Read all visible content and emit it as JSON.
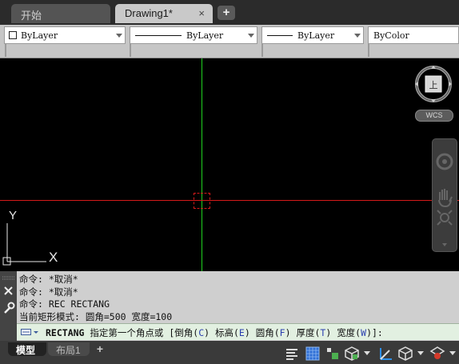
{
  "tabs": {
    "start_label": "开始",
    "drawing_label": "Drawing1*",
    "close_glyph": "×",
    "add_glyph": "+"
  },
  "properties": {
    "color": "ByLayer",
    "linetype": "ByLayer",
    "lineweight": "ByLayer",
    "plotstyle": "ByColor"
  },
  "canvas": {
    "background": "#000000",
    "crosshair_x_color": "#d41a1a",
    "crosshair_y_color": "#1fd11f",
    "ucs_x_label": "X",
    "ucs_y_label": "Y"
  },
  "viewcube": {
    "face_label": "上",
    "wcs_label": "WCS"
  },
  "command": {
    "history": [
      "命令: *取消*",
      "命令: *取消*",
      "命令: REC RECTANG",
      "当前矩形模式:  圆角=500  宽度=100"
    ],
    "prompt_command": "RECTANG",
    "prompt_text": " 指定第一个角点或 [",
    "options": [
      {
        "label": "倒角(",
        "key": "C",
        "close": ") "
      },
      {
        "label": "标高(",
        "key": "E",
        "close": ") "
      },
      {
        "label": "圆角(",
        "key": "F",
        "close": ") "
      },
      {
        "label": "厚度(",
        "key": "T",
        "close": ") "
      },
      {
        "label": "宽度(",
        "key": "W",
        "close": ")"
      }
    ],
    "prompt_end": "]:"
  },
  "layout_tabs": {
    "model": "模型",
    "layout1": "布局1",
    "add": "+"
  }
}
